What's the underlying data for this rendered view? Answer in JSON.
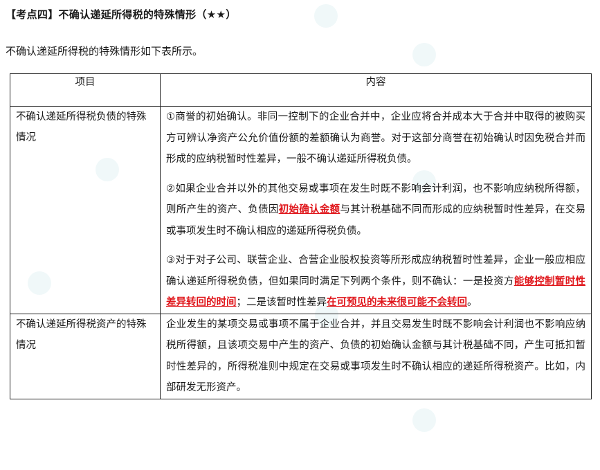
{
  "heading": "【考点四】不确认递延所得税的特殊情形（★★）",
  "intro": "不确认递延所得税的特殊情形如下表所示。",
  "table": {
    "headers": {
      "item": "项目",
      "content": "内容"
    },
    "row1": {
      "label": "不确认递延所得税负债的特殊情况",
      "p1": "①商誉的初始确认。非同一控制下的企业合并中，企业应将合并成本大于合并中取得的被购买方可辨认净资产公允价值份额的差额确认为商誉。对于这部分商誉在初始确认时因免税合并而形成的应纳税暂时性差异，一般不确认递延所得税负债。",
      "p2a": "②如果企业合并以外的其他交易或事项在发生时既不影响会计利润，也不影响应纳税所得额，则所产生的资产、负债因",
      "p2b": "初始确认金额",
      "p2c": "与其计税基础不同而形成的应纳税暂时性差异，在交易或事项发生时不确认相应的递延所得税负债。",
      "p3a": "③对于对子公司、联营企业、合营企业股权投资等所形成应纳税暂时性差异，企业一般应相应确认递延所得税负债，但如果同时满足下列两个条件，则不确认：一是投资方",
      "p3b": "能够控制暂时性差异转回的时间",
      "p3c": "；二是该暂时性差异",
      "p3d": "在可预见的未来很可能不会转回",
      "p3e": "。"
    },
    "row2": {
      "label": "不确认递延所得税资产的特殊情况",
      "p1": "企业发生的某项交易或事项不属于企业合并，并且交易发生时既不影响会计利润也不影响应纳税所得额，且该项交易中产生的资产、负债的初始确认金额与其计税基础不同，产生可抵扣暂时性差异的，所得税准则中规定在交易或事项发生时不确认相应的递延所得税资产。比如，内部研发无形资产。"
    }
  },
  "colors": {
    "emphasis": "#e0161b",
    "watermark": "#e3f2f4"
  }
}
